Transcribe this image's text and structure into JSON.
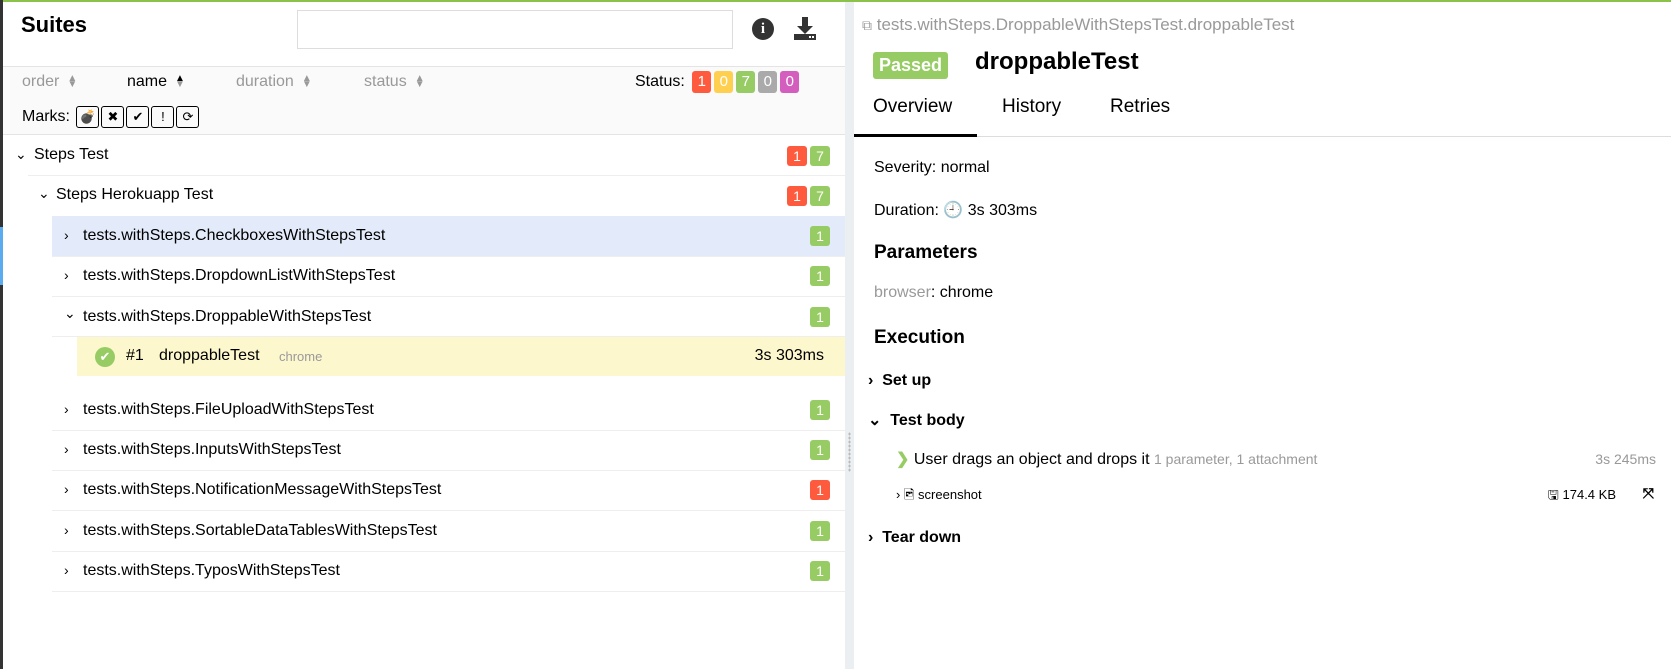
{
  "colors": {
    "failed": "#fd5a3e",
    "broken": "#ffd050",
    "passed": "#97cc64",
    "skipped": "#aaaaaa",
    "unknown": "#d35ebe",
    "selected_row": "#e3ebfa",
    "active_test": "#fdf7cd",
    "accent": "#8bc34a"
  },
  "suites": {
    "title": "Suites",
    "search_placeholder": "",
    "info_icon": "info-circle-icon",
    "download_icon": "download-icon",
    "sort": [
      {
        "label": "order",
        "active": false
      },
      {
        "label": "name",
        "active": true,
        "direction": "asc"
      },
      {
        "label": "duration",
        "active": false
      },
      {
        "label": "status",
        "active": false
      }
    ],
    "status_label": "Status:",
    "status_counts": {
      "failed": "1",
      "broken": "0",
      "passed": "7",
      "skipped": "0",
      "unknown": "0"
    },
    "marks_label": "Marks:",
    "marks": [
      "flaky-bomb-icon",
      "new-failed-icon",
      "new-passed-icon",
      "new-broken-icon",
      "retries-icon"
    ],
    "tree": {
      "root": {
        "label": "Steps Test",
        "failed": "1",
        "passed": "7"
      },
      "child": {
        "label": "Steps Herokuapp Test",
        "failed": "1",
        "passed": "7"
      },
      "classes": [
        {
          "label": "tests.withSteps.CheckboxesWithStepsTest",
          "count": "1",
          "status": "passed"
        },
        {
          "label": "tests.withSteps.DropdownListWithStepsTest",
          "count": "1",
          "status": "passed"
        },
        {
          "label": "tests.withSteps.DroppableWithStepsTest",
          "count": "1",
          "status": "passed",
          "expanded": true
        },
        {
          "label": "tests.withSteps.FileUploadWithStepsTest",
          "count": "1",
          "status": "passed"
        },
        {
          "label": "tests.withSteps.InputsWithStepsTest",
          "count": "1",
          "status": "passed"
        },
        {
          "label": "tests.withSteps.NotificationMessageWithStepsTest",
          "count": "1",
          "status": "failed"
        },
        {
          "label": "tests.withSteps.SortableDataTablesWithStepsTest",
          "count": "1",
          "status": "passed"
        },
        {
          "label": "tests.withSteps.TyposWithStepsTest",
          "count": "1",
          "status": "passed"
        }
      ],
      "test": {
        "index": "#1",
        "name": "droppableTest",
        "param": "chrome",
        "duration": "3s 303ms",
        "status": "passed"
      }
    }
  },
  "detail": {
    "full_name": "tests.withSteps.DroppableWithStepsTest.droppableTest",
    "status": "Passed",
    "name": "droppableTest",
    "tabs": [
      {
        "label": "Overview",
        "active": true
      },
      {
        "label": "History"
      },
      {
        "label": "Retries"
      }
    ],
    "severity": "Severity: normal",
    "duration_label": "Duration:",
    "duration": "3s 303ms",
    "parameters_title": "Parameters",
    "param_name": "browser",
    "param_value": ": chrome",
    "execution_title": "Execution",
    "setup": "Set up",
    "test_body": "Test body",
    "step": {
      "label": "User drags an object and drops it",
      "meta": "1 parameter, 1 attachment",
      "duration": "3s 245ms"
    },
    "attachment": {
      "name": "screenshot",
      "size": "174.4 KB"
    },
    "teardown": "Tear down"
  }
}
